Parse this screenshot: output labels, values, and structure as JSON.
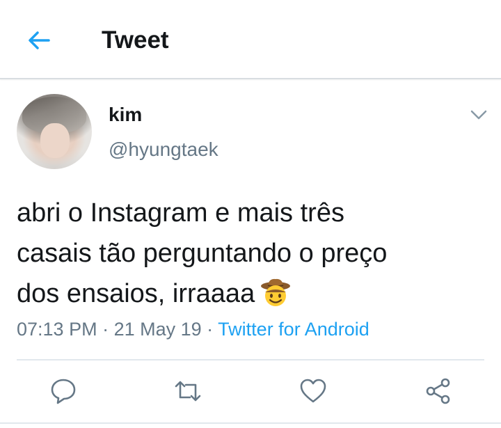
{
  "header": {
    "back_icon": "arrow-left-icon",
    "title": "Tweet",
    "accent_color": "#1da1f2"
  },
  "tweet": {
    "author_name": "kim",
    "author_handle": "@hyungtaek",
    "menu_icon": "chevron-down-icon",
    "text": "abri o Instagram e mais três\ncasais tão perguntando o preço\ndos ensaios, irraaaa",
    "emoji": "cowboy-hat-face-emoji",
    "time": "07:13 PM",
    "separator": " · ",
    "date": "21 May 19",
    "source": "Twitter for Android"
  },
  "actions": [
    {
      "name": "reply",
      "icon": "reply-icon"
    },
    {
      "name": "retweet",
      "icon": "retweet-icon"
    },
    {
      "name": "like",
      "icon": "heart-icon"
    },
    {
      "name": "share",
      "icon": "share-icon"
    }
  ],
  "colors": {
    "text": "#14171a",
    "secondary": "#657786",
    "link": "#1da1f2",
    "divider": "#e1e8ed"
  }
}
